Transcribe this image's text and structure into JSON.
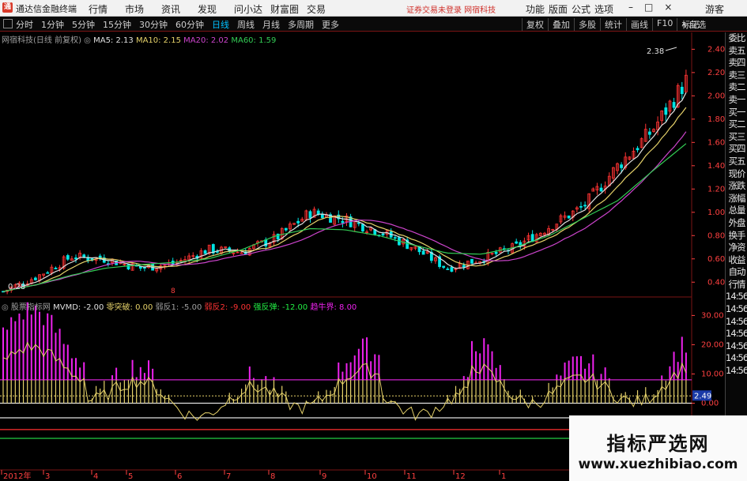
{
  "titlebar": {
    "app_title": "通达信金融终端",
    "menu": [
      "行情",
      "市场",
      "资讯",
      "发现",
      "问小达",
      "财富圈",
      "交易"
    ],
    "notice": "证券交易未登录   网宿科技",
    "right_menu": [
      "功能",
      "版面",
      "公式",
      "选项"
    ],
    "guest": "游客"
  },
  "toolbar": {
    "periods": [
      "分时",
      "1分钟",
      "5分钟",
      "15分钟",
      "30分钟",
      "60分钟",
      "日线",
      "周线",
      "月线",
      "多周期",
      "更多"
    ],
    "active_period": "日线",
    "tools": [
      "复权",
      "叠加",
      "多股",
      "统计",
      "画线",
      "F10",
      "标记",
      "+自选"
    ]
  },
  "main_chart": {
    "stock_title": "网宿科技(日线 前复权)",
    "ma5_label": "MA5: 2.13",
    "ma10_label": "MA10: 2.15",
    "ma20_label": "MA20: 2.02",
    "ma60_label": "MA60: 1.59",
    "high_marker": "2.38",
    "low_marker": "0.28",
    "price_axis": [
      "2.40",
      "2.20",
      "2.00",
      "1.80",
      "1.60",
      "1.40",
      "1.20",
      "1.00",
      "0.80",
      "0.60",
      "0.40"
    ],
    "current_price_tag": "8"
  },
  "sub_chart": {
    "indicator_name": "股票指标网",
    "mvmd": "MVMD: -2.00",
    "zero_break": "零突破: 0.00",
    "weak_rebound1": "弱反1: -5.00",
    "weak_rebound2": "弱反2: -9.00",
    "strong_rebound": "强反弹: -12.00",
    "bull_trend": "趋牛界: 8.00",
    "axis": [
      "30.00",
      "20.00",
      "10.00",
      "0.00"
    ],
    "current_value": "2.49"
  },
  "x_axis": [
    "2012年",
    "3",
    "4",
    "5",
    "6",
    "7",
    "8",
    "9",
    "10",
    "11",
    "12",
    "1"
  ],
  "right_panel": [
    "委比",
    "卖五",
    "卖四",
    "卖三",
    "卖二",
    "卖一",
    "买一",
    "买二",
    "买三",
    "买四",
    "买五",
    "现价",
    "涨跌",
    "涨幅",
    "总量",
    "外盘",
    "换手",
    "净资",
    "收益",
    "自动",
    "行情",
    "14:56",
    "14:56",
    "14:56",
    "14:56",
    "14:56",
    "14:56",
    "14:56"
  ],
  "watermark": {
    "title": "指标严选网",
    "url": "www.xuezhibiao.com"
  },
  "colors": {
    "up": "#ff3333",
    "down": "#00e5e5",
    "ma5": "#e0e0e0",
    "ma10": "#e6d26a",
    "ma20": "#cc44cc",
    "ma60": "#33cc55",
    "indicator_pos": "#ee22ee",
    "indicator_neg": "#22ee44",
    "indicator_line": "#e6d26a"
  },
  "chart_data": {
    "type": "line",
    "title": "网宿科技(日线 前复权)",
    "ylim": [
      0.2,
      2.5
    ],
    "series": [
      {
        "name": "MA5",
        "values": [
          0.32,
          0.45,
          0.62,
          0.6,
          0.52,
          0.56,
          0.68,
          0.66,
          0.78,
          1.0,
          0.94,
          0.84,
          0.7,
          0.52,
          0.6,
          0.7,
          0.88,
          1.05,
          1.4,
          1.7,
          2.13
        ]
      },
      {
        "name": "MA60",
        "values": [
          0.32,
          0.38,
          0.46,
          0.52,
          0.55,
          0.57,
          0.6,
          0.68,
          0.8,
          0.86,
          0.85,
          0.8,
          0.72,
          0.65,
          0.64,
          0.7,
          0.8,
          0.95,
          1.1,
          1.35,
          1.59
        ]
      }
    ]
  }
}
